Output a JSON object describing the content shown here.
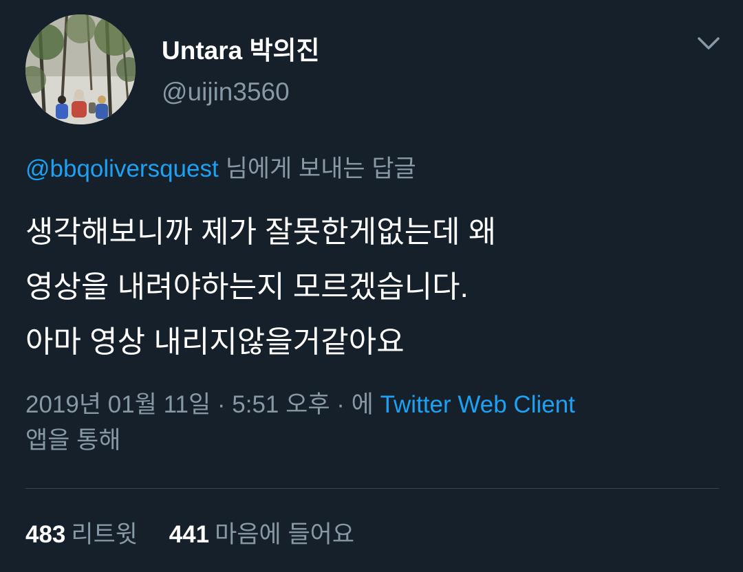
{
  "user": {
    "display_name": "Untara 박의진",
    "handle": "@uijin3560",
    "avatar": "profile-photo-hikers-in-forest"
  },
  "reply": {
    "to_handle": "@bbqoliversquest",
    "suffix": "님에게 보내는 답글"
  },
  "tweet": {
    "lines": [
      "생각해보니까 제가 잘못한게없는데 왜",
      "영상을 내려야하는지 모르겠습니다.",
      "아마 영상 내리지않을거같아요"
    ]
  },
  "meta": {
    "timestamp": "2019년 01월 11일 · 5:51 오후 · 에 ",
    "source": "Twitter Web Client",
    "via": "앱을 통해"
  },
  "stats": {
    "retweets_count": "483",
    "retweets_label": "리트윗",
    "likes_count": "441",
    "likes_label": "마음에 들어요"
  },
  "icons": {
    "more": "chevron-down-icon"
  },
  "colors": {
    "background": "#15202b",
    "accent": "#1da1f2",
    "secondary_text": "#8899a6",
    "divider": "#38444d"
  }
}
